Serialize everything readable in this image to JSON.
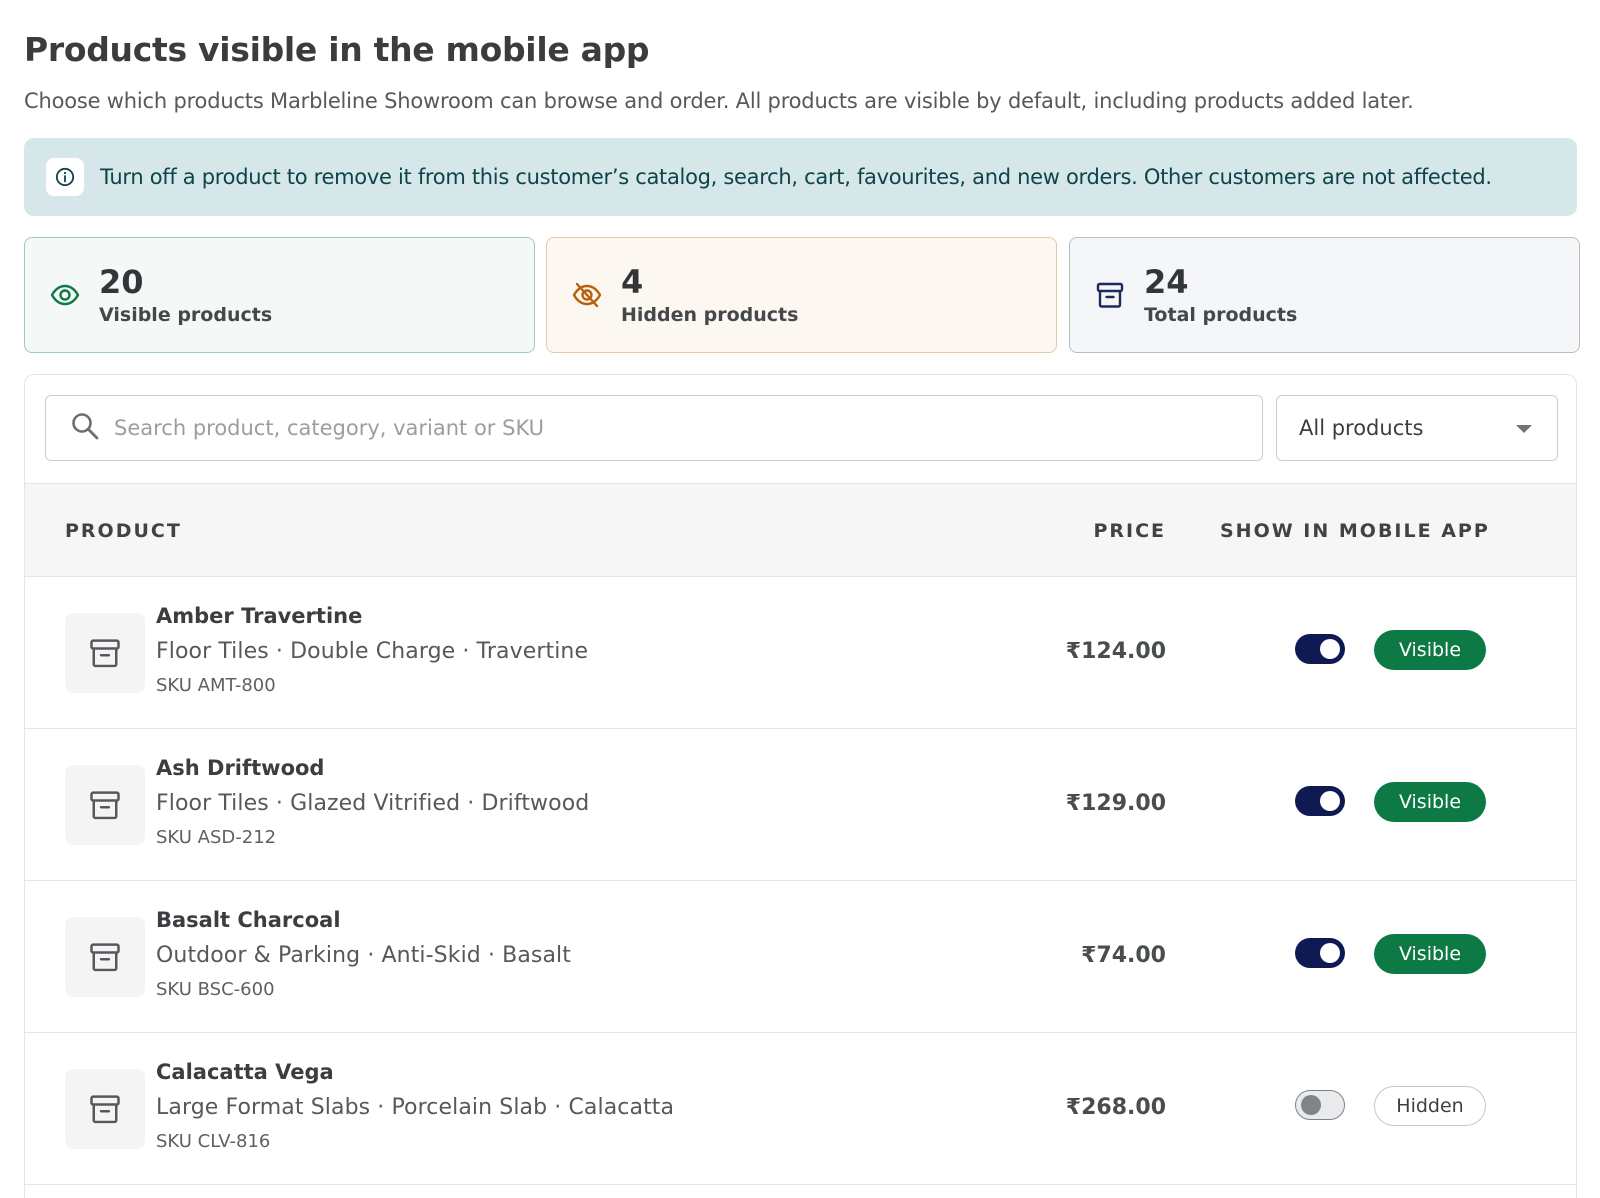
{
  "header": {
    "title": "Products visible in the mobile app",
    "subtitle": "Choose which products Marbleline Showroom can browse and order. All products are visible by default, including products added later."
  },
  "info_banner": {
    "icon": "info-icon",
    "text": "Turn off a product to remove it from this customer’s catalog, search, cart, favourites, and new orders. Other customers are not affected."
  },
  "stats": {
    "visible": {
      "count": "20",
      "label": "Visible products",
      "icon": "eye-icon"
    },
    "hidden": {
      "count": "4",
      "label": "Hidden products",
      "icon": "eye-off-icon"
    },
    "total": {
      "count": "24",
      "label": "Total products",
      "icon": "archive-icon"
    }
  },
  "search": {
    "placeholder": "Search product, category, variant or SKU",
    "value": ""
  },
  "filter": {
    "selected": "All products"
  },
  "table": {
    "columns": {
      "product": "PRODUCT",
      "price": "PRICE",
      "show": "SHOW IN MOBILE APP"
    },
    "rows": [
      {
        "name": "Amber Travertine",
        "meta": "Floor Tiles · Double Charge · Travertine",
        "sku": "SKU AMT-800",
        "price": "₹124.00",
        "visible": true,
        "status": "Visible"
      },
      {
        "name": "Ash Driftwood",
        "meta": "Floor Tiles · Glazed Vitrified · Driftwood",
        "sku": "SKU ASD-212",
        "price": "₹129.00",
        "visible": true,
        "status": "Visible"
      },
      {
        "name": "Basalt Charcoal",
        "meta": "Outdoor & Parking · Anti-Skid · Basalt",
        "sku": "SKU BSC-600",
        "price": "₹74.00",
        "visible": true,
        "status": "Visible"
      },
      {
        "name": "Calacatta Vega",
        "meta": "Large Format Slabs · Porcelain Slab · Calacatta",
        "sku": "SKU CLV-816",
        "price": "₹268.00",
        "visible": false,
        "status": "Hidden"
      }
    ]
  },
  "colors": {
    "toggle_on": "#101a52",
    "visible_badge": "#0d7a45",
    "banner_bg": "#d6e7ea"
  }
}
